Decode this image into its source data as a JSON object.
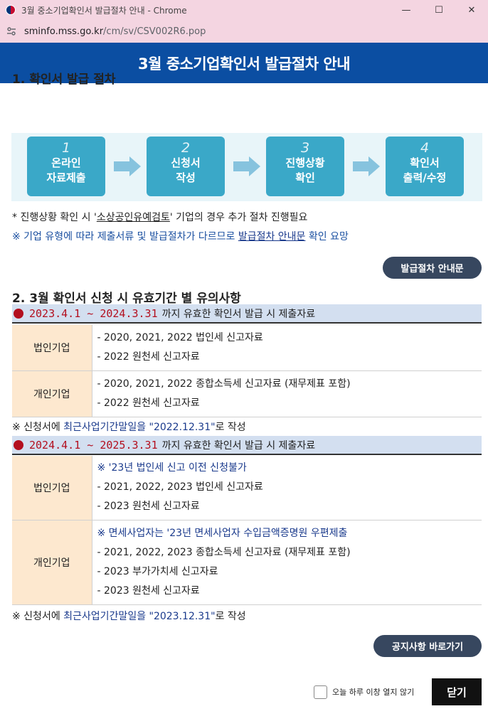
{
  "window": {
    "title": "3월 중소기업확인서 발급절차 안내 - Chrome",
    "url_host": "sminfo.mss.go.kr",
    "url_path": "/cm/sv/CSV002R6.pop",
    "controls": {
      "minimize": "—",
      "maximize": "☐",
      "close": "✕"
    }
  },
  "header": {
    "title": "3월 중소기업확인서 발급절차 안내"
  },
  "section1": {
    "title": "1. 확인서 발급 절차",
    "steps": [
      {
        "num": "1",
        "line1": "온라인",
        "line2": "자료제출"
      },
      {
        "num": "2",
        "line1": "신청서",
        "line2": "작성"
      },
      {
        "num": "3",
        "line1": "진행상황",
        "line2": "확인"
      },
      {
        "num": "4",
        "line1": "확인서",
        "line2": "출력/수정"
      }
    ],
    "note1_pre": "* 진행상황 확인 시 '",
    "note1_u": "소상공인유예검토",
    "note1_post": "' 기업의 경우 추가 절차 진행필요",
    "note2_pre": "※ 기업 유형에 따라 제출서류 및 발급절차가 다르므로 ",
    "note2_link": "발급절차 안내문",
    "note2_post": " 확인 요망",
    "guide_button": "발급절차 안내문"
  },
  "section2": {
    "title": "2. 3월 확인서 신청 시 유효기간 별 유의사항",
    "periods": [
      {
        "dates": "2023.4.1 ~ 2024.3.31",
        "rest": "까지 유효한 확인서 발급 시 제출자료",
        "corp_label": "법인기업",
        "corp_lines": [
          "- 2020, 2021, 2022 법인세 신고자료",
          "- 2022 원천세 신고자료"
        ],
        "indiv_label": "개인기업",
        "indiv_lines": [
          "- 2020, 2021, 2022 종합소득세 신고자료 (재무제표 포함)",
          "- 2022 원천세 신고자료"
        ],
        "note_pre": "※ 신청서에 ",
        "note_blue": "최근사업기간말일을 \"2022.12.31\"",
        "note_post": "로 작성"
      },
      {
        "dates": "2024.4.1 ~ 2025.3.31",
        "rest": "까지 유효한 확인서 발급 시 제출자료",
        "corp_label": "법인기업",
        "corp_blue": "※ '23년 법인세 신고 이전 신청불가",
        "corp_lines": [
          "- 2021, 2022, 2023 법인세 신고자료",
          "- 2023 원천세 신고자료"
        ],
        "indiv_label": "개인기업",
        "indiv_blue": "※ 면세사업자는 '23년 면세사업자 수입금액증명원 우편제출",
        "indiv_lines": [
          "- 2021, 2022, 2023 종합소득세 신고자료 (재무제표 포함)",
          "- 2023 부가가치세 신고자료",
          "- 2023 원천세 신고자료"
        ],
        "note_pre": "※ 신청서에 ",
        "note_blue": "최근사업기간말일을 \"2023.12.31\"",
        "note_post": "로 작성"
      }
    ],
    "notice_button": "공지사항 바로가기"
  },
  "footer": {
    "checkbox_label": "오늘 하루 이창 열지 않기",
    "close_button": "닫기"
  }
}
